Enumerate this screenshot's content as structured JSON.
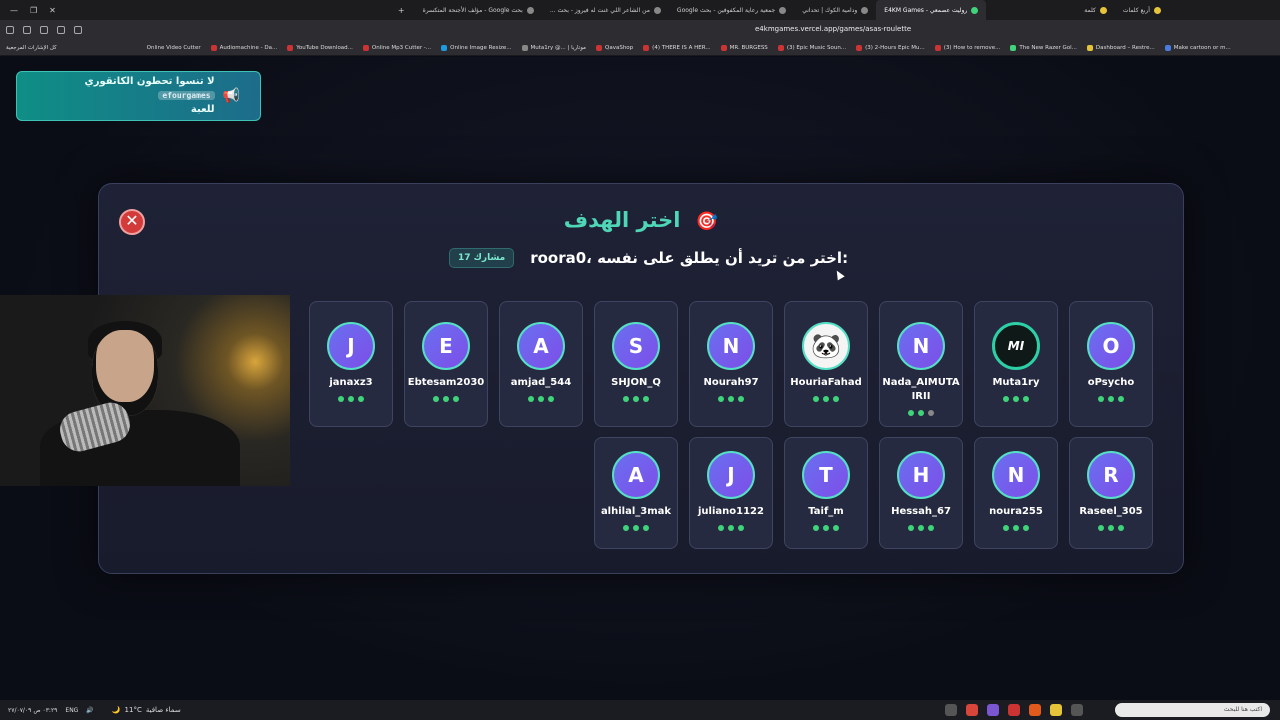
{
  "browser": {
    "tabs": [
      {
        "label": "بحث Google - مؤلف الأجنحة المتكسرة"
      },
      {
        "label": "من الشاعر اللي غنت له فيروز - بحث ..."
      },
      {
        "label": "جمعية رعاية المكفوفين - بحث Google"
      },
      {
        "label": "ودامية الكوك | تحداني"
      },
      {
        "label": "روليت عصمعي - E4KM Games",
        "active": true
      },
      {
        "label": "كلمة"
      },
      {
        "label": "أربع كلمات"
      }
    ],
    "url": "e4kmgames.vercel.app/games/asas-roulette",
    "bookmarks": [
      "كل الإشارات المرجعية",
      "Online Video Cutter",
      "Audiomachine - Da...",
      "YouTube Download...",
      "Online Mp3 Cutter -...",
      "Online Image Resize...",
      "Muta1ry @... | موتاريا",
      "QavaShop",
      "(4) THERE IS A HER...",
      "MR. BURGESS",
      "(3) Epic Music Soun...",
      "(3) 2-Hours Epic Mu...",
      "(3) How to remove...",
      "The New Razer Gol...",
      "Dashboard – Restre...",
      "Make cartoon or m..."
    ]
  },
  "toast": {
    "text_line1": "لا تنسوا تحطون الكاتقوري",
    "brand": "efourgames",
    "text_line2": "للعبة",
    "icon": "megaphone-icon"
  },
  "modal": {
    "title": "اختر الهدف",
    "title_icon": "target-icon",
    "subtitle": "roora0، اختر من تريد أن يطلق على نفسه:",
    "participants_badge": "17 مشارك",
    "close_label": "✕",
    "players_row1": [
      {
        "initial": "O",
        "name": "oPsycho",
        "dots": [
          true,
          true,
          true
        ],
        "avatar": "letter"
      },
      {
        "initial": "MI",
        "name": "Muta1ry",
        "dots": [
          true,
          true,
          true
        ],
        "avatar": "logo"
      },
      {
        "initial": "N",
        "name": "Nada_AIMUTAIRII",
        "dots": [
          true,
          true,
          false
        ],
        "avatar": "letter"
      },
      {
        "initial": "🐼",
        "name": "HouriaFahad",
        "dots": [
          true,
          true,
          true
        ],
        "avatar": "panda"
      },
      {
        "initial": "N",
        "name": "Nourah97",
        "dots": [
          true,
          true,
          true
        ],
        "avatar": "letter"
      },
      {
        "initial": "S",
        "name": "SHJON_Q",
        "dots": [
          true,
          true,
          true
        ],
        "avatar": "letter"
      },
      {
        "initial": "A",
        "name": "amjad_544",
        "dots": [
          true,
          true,
          true
        ],
        "avatar": "letter"
      },
      {
        "initial": "E",
        "name": "Ebtesam2030",
        "dots": [
          true,
          true,
          true
        ],
        "avatar": "letter"
      },
      {
        "initial": "J",
        "name": "janaxz3",
        "dots": [
          true,
          true,
          true
        ],
        "avatar": "letter"
      }
    ],
    "players_row2": [
      {
        "initial": "R",
        "name": "Raseel_305",
        "dots": [
          true,
          true,
          true
        ],
        "avatar": "letter"
      },
      {
        "initial": "N",
        "name": "noura255",
        "dots": [
          true,
          true,
          true
        ],
        "avatar": "letter"
      },
      {
        "initial": "H",
        "name": "Hessah_67",
        "dots": [
          true,
          true,
          true
        ],
        "avatar": "letter"
      },
      {
        "initial": "T",
        "name": "Taif_m",
        "dots": [
          true,
          true,
          true
        ],
        "avatar": "letter"
      },
      {
        "initial": "J",
        "name": "juliano1122",
        "dots": [
          true,
          true,
          true
        ],
        "avatar": "letter"
      },
      {
        "initial": "A",
        "name": "alhilal_3mak",
        "dots": [
          true,
          true,
          true
        ],
        "avatar": "letter"
      }
    ]
  },
  "taskbar": {
    "weather_temp": "11°C",
    "weather_text": "سماء صافية",
    "language": "ENG",
    "clock_time": "٠٣:٢٩ ص",
    "clock_date": "٢٧/٠٧/٠٩",
    "search_placeholder": "اكتب هنا للبحث"
  },
  "colors": {
    "accent": "#4fd6b6",
    "close": "#d33a3a",
    "dot_on": "#3fd47a",
    "dot_off": "#888888"
  }
}
